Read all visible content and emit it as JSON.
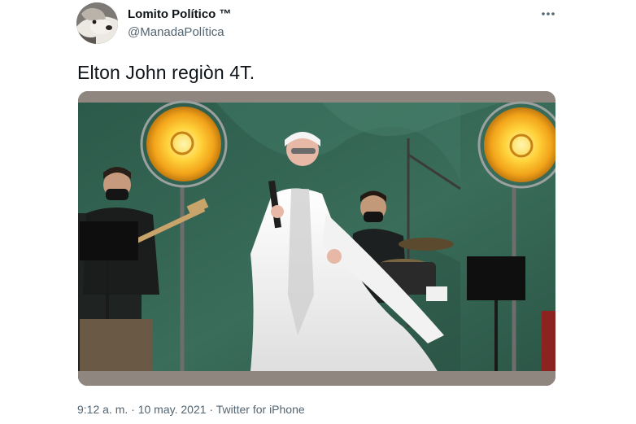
{
  "author": {
    "display_name": "Lomito Político ™",
    "handle": "@ManadaPolítica"
  },
  "tweet": {
    "text": "Elton John regiòn 4T."
  },
  "media": {
    "type": "video-still",
    "scene": "stage-performer-with-microphone"
  },
  "meta": {
    "time": "9:12 a. m.",
    "separator": " · ",
    "date": "10 may. 2021",
    "source": "Twitter for iPhone"
  },
  "icons": {
    "more": "more-horizontal-icon",
    "avatar": "dog-avatar"
  },
  "colors": {
    "text_primary": "#0f1419",
    "text_secondary": "#536471",
    "stage_backdrop": "#2f5a4c"
  }
}
